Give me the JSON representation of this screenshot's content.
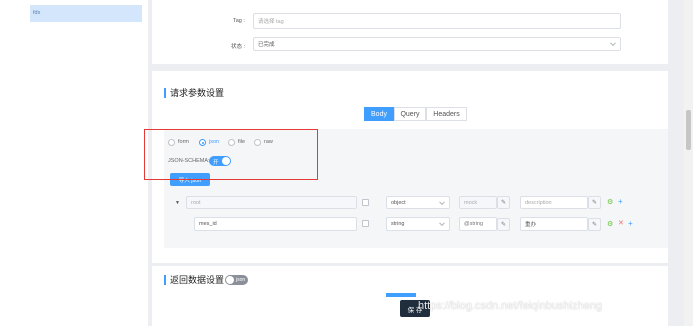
{
  "sidebar": {
    "selected_item": "fdx"
  },
  "top_form": {
    "tag_label": "Tag :",
    "tag_placeholder": "请选择 tag",
    "status_label": "状态 :",
    "status_value": "已完成"
  },
  "request": {
    "section_title": "请求参数设置",
    "tabs": [
      {
        "label": "Body",
        "active": true
      },
      {
        "label": "Query",
        "active": false
      },
      {
        "label": "Headers",
        "active": false
      }
    ],
    "body_types": [
      {
        "label": "form",
        "selected": false
      },
      {
        "label": "json",
        "selected": true
      },
      {
        "label": "file",
        "selected": false
      },
      {
        "label": "raw",
        "selected": false
      }
    ],
    "json_schema_label": "JSON-SCHEMA:",
    "json_schema_toggle": "开",
    "import_button": "导入 json",
    "schema_rows": [
      {
        "name": "root",
        "type": "object",
        "mock": "mock",
        "description": "description",
        "expanded": true
      },
      {
        "name": "mes_id",
        "type": "string",
        "mock": "@string",
        "description": "重办"
      }
    ]
  },
  "response": {
    "section_title": "返回数据设置",
    "toggle_label": "json"
  },
  "footer": {
    "save_button": "保 存"
  },
  "watermark": "https://blog.csdn.net/feiqinbushizheng",
  "colors": {
    "accent": "#409eff",
    "highlight_border": "#e53935",
    "save_bg": "#1f2d3d"
  }
}
